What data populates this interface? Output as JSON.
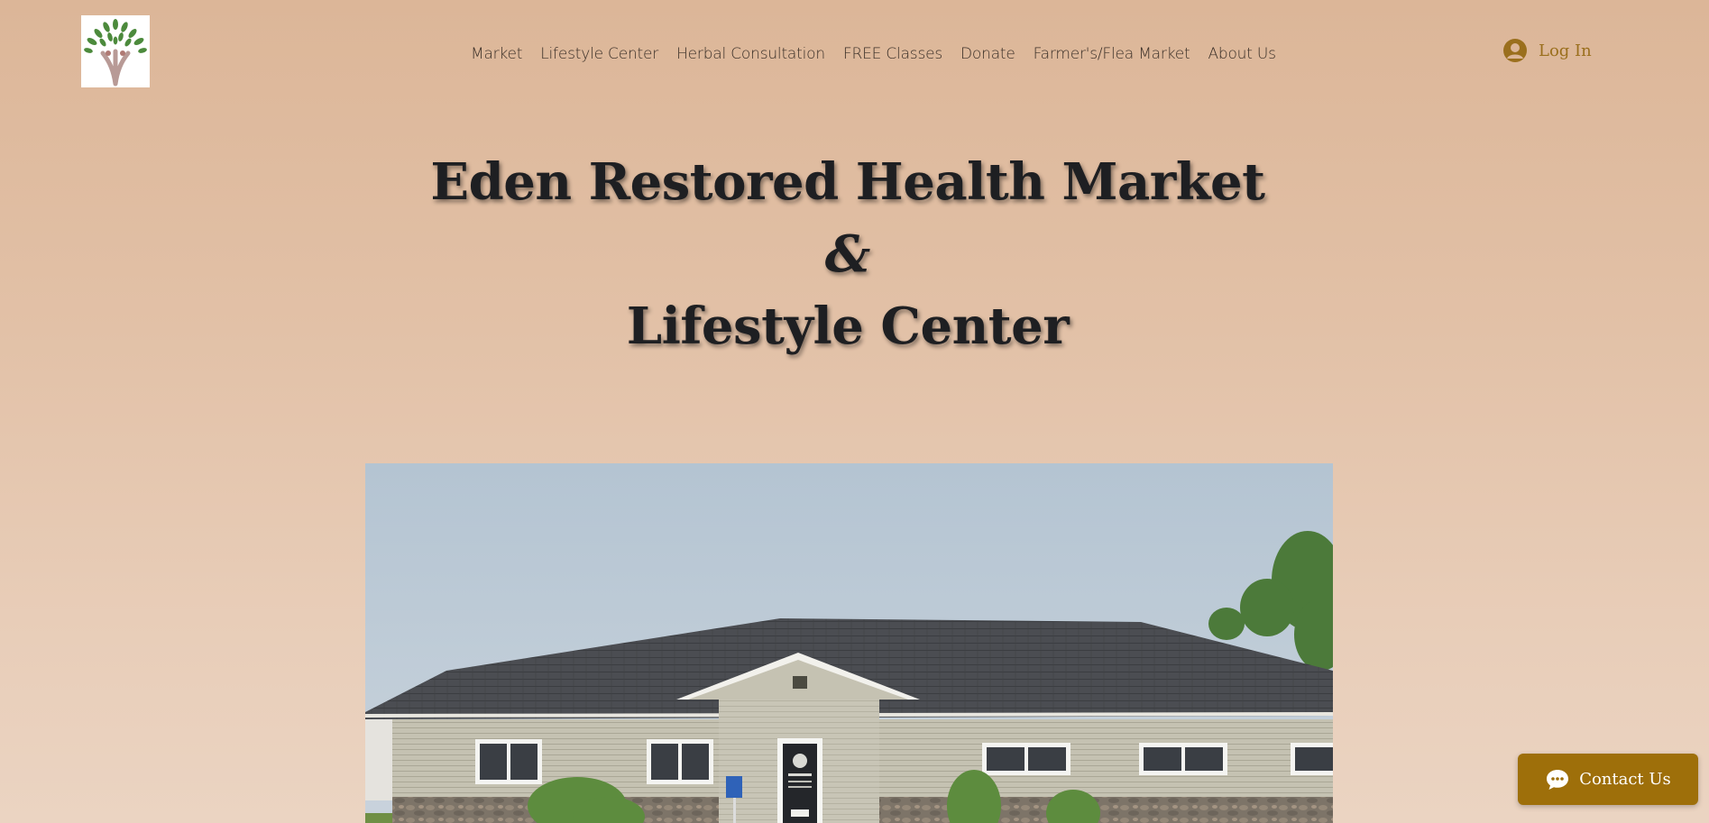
{
  "header": {
    "logo_name": "tree-logo",
    "nav": [
      {
        "label": "Market"
      },
      {
        "label": "Lifestyle Center"
      },
      {
        "label": "Herbal Consultation"
      },
      {
        "label": "FREE Classes"
      },
      {
        "label": "Donate"
      },
      {
        "label": "Farmer's/Flea Market"
      },
      {
        "label": "About Us"
      }
    ],
    "login": {
      "label": "Log In",
      "icon": "user-avatar-icon"
    }
  },
  "hero": {
    "line1": "Eden Restored Health Market",
    "ampersand": "&",
    "line2": "Lifestyle Center"
  },
  "contact_widget": {
    "label": "Contact Us",
    "icon": "chat-bubble-icon"
  },
  "colors": {
    "accent": "#9e6f0a",
    "login_text": "#9a6f1d",
    "nav_text": "#3a2f27",
    "title_text": "#1e1f22",
    "background_top": "#dcb698",
    "background_bottom": "#ebd4c2"
  }
}
